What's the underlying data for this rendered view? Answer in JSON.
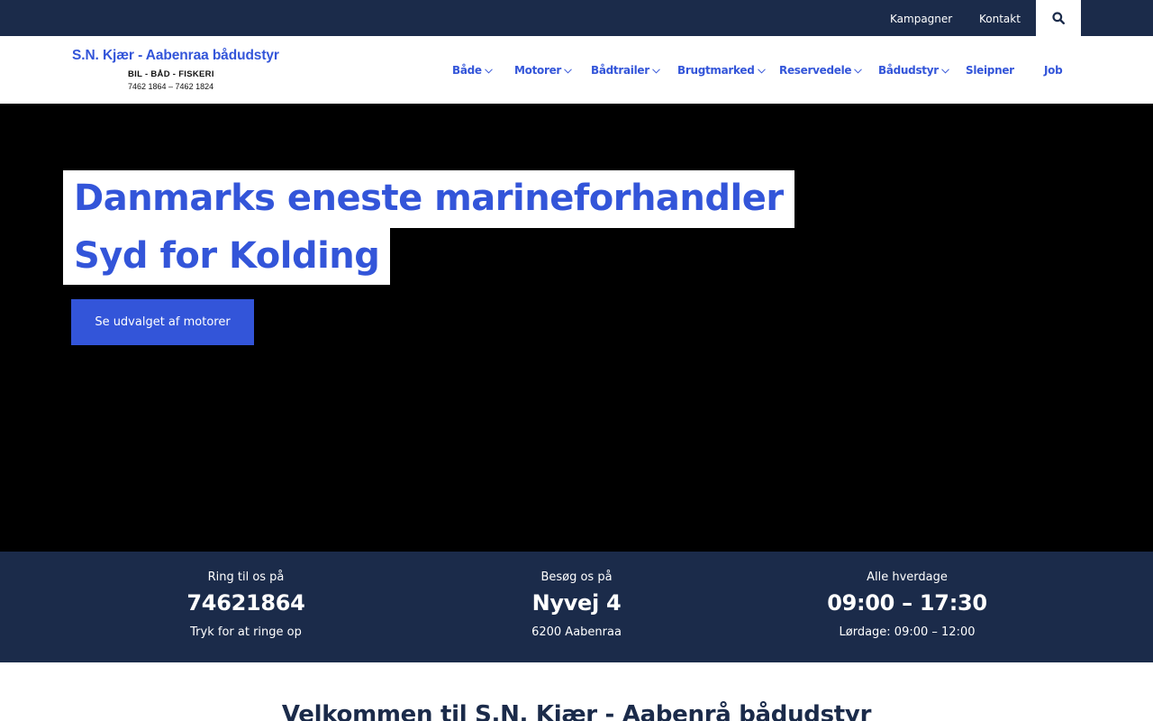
{
  "topbar": {
    "links": [
      {
        "label": "Kampagner"
      },
      {
        "label": "Kontakt"
      }
    ],
    "search_icon": "search-icon"
  },
  "logo": {
    "title": "S.N. Kjær - Aabenraa bådudstyr",
    "tagline": "BIL - BÅD - FISKERI",
    "phones": "7462 1864 – 7462 1824"
  },
  "nav": {
    "items": [
      {
        "label": "Både",
        "has_dropdown": true
      },
      {
        "label": "Motorer",
        "has_dropdown": true
      },
      {
        "label": "Bådtrailer",
        "has_dropdown": true
      },
      {
        "label": "Brugtmarked",
        "has_dropdown": true
      },
      {
        "label": "Reservedele",
        "has_dropdown": true
      },
      {
        "label": "Bådudstyr",
        "has_dropdown": true
      },
      {
        "label": "Sleipner",
        "has_dropdown": false
      },
      {
        "label": "Job",
        "has_dropdown": false
      }
    ]
  },
  "hero": {
    "headline_line1": "Danmarks eneste marineforhandler",
    "headline_line2": "Syd for Kolding",
    "cta_label": "Se udvalget af motorer"
  },
  "info": {
    "phone": {
      "label": "Ring til os på",
      "value": "74621864",
      "sub": "Tryk for at ringe op"
    },
    "address": {
      "label": "Besøg os på",
      "value": "Nyvej 4",
      "sub": "6200 Aabenraa"
    },
    "hours": {
      "label": "Alle hverdage",
      "value": "09:00 – 17:30",
      "sub": "Lørdage: 09:00 – 12:00"
    }
  },
  "welcome": {
    "heading": "Velkommen til S.N. Kjær - Aabenrå bådudstyr"
  },
  "colors": {
    "navy": "#1b2b4a",
    "accent_blue": "#3355d9",
    "hero_bg": "#000000",
    "white": "#ffffff"
  }
}
